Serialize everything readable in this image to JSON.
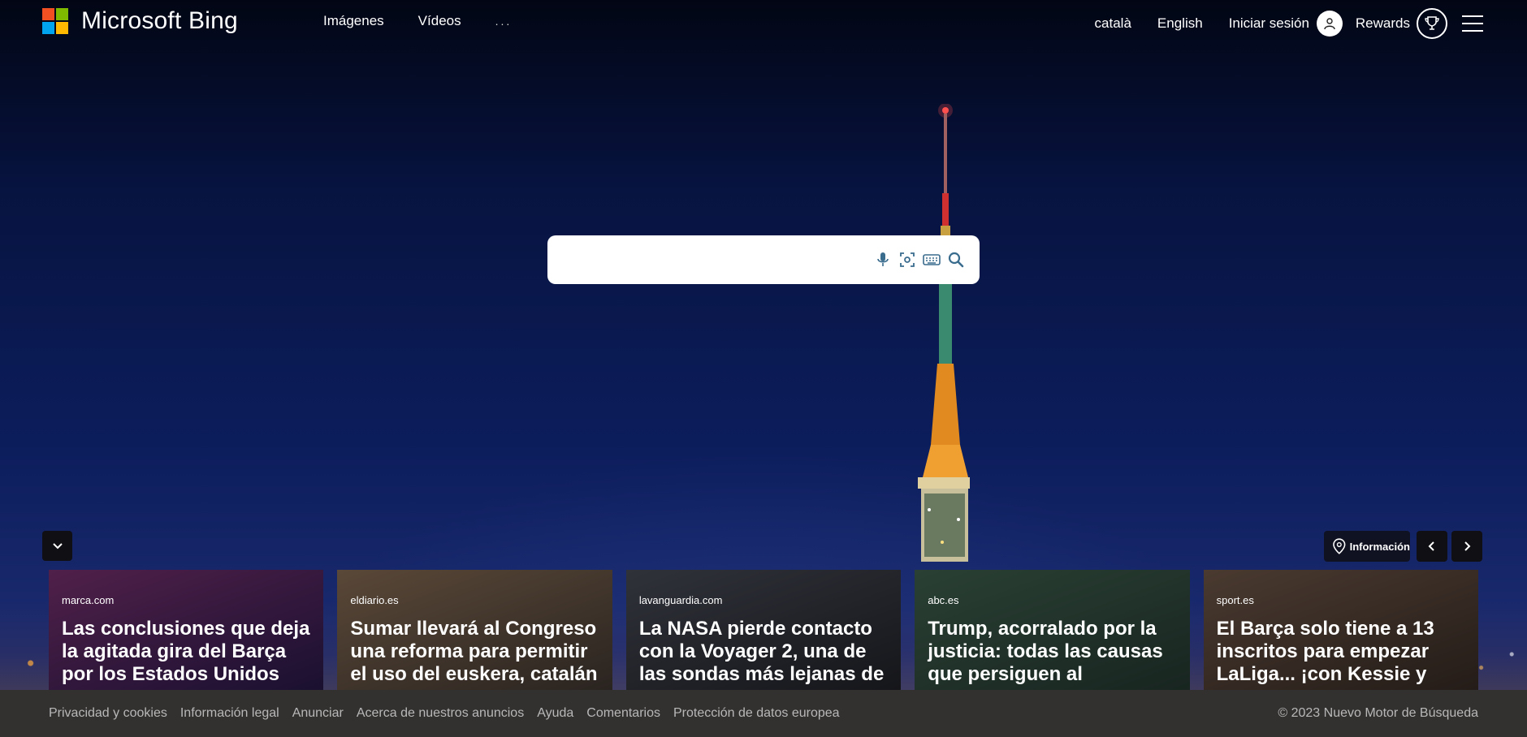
{
  "header": {
    "brand": "Microsoft Bing",
    "nav": [
      "Imágenes",
      "Vídeos",
      "..."
    ],
    "languages": [
      "català",
      "English"
    ],
    "signin_label": "Iniciar sesión",
    "rewards_label": "Rewards"
  },
  "logo_colors": [
    "#f25022",
    "#7fba00",
    "#00a4ef",
    "#ffb900"
  ],
  "search": {
    "placeholder": "",
    "icons": [
      "microphone-icon",
      "visual-search-icon",
      "keyboard-icon",
      "search-icon"
    ]
  },
  "controls": {
    "info_label": "Información"
  },
  "cards": [
    {
      "source": "marca.com",
      "title": "Las conclusiones que deja la agitada gira del Barça por los Estados Unidos",
      "bg": "#3a1c3a"
    },
    {
      "source": "eldiario.es",
      "title": "Sumar llevará al Congreso una reforma para permitir el uso del euskera, catalán",
      "bg": "#4a3a30"
    },
    {
      "source": "lavanguardia.com",
      "title": "La NASA pierde contacto con la Voyager 2, una de las sondas más lejanas de",
      "bg": "#24252a"
    },
    {
      "source": "abc.es",
      "title": "Trump, acorralado por la justicia: todas las causas que persiguen al",
      "bg": "#2a3a30"
    },
    {
      "source": "sport.es",
      "title": "El Barça solo tiene a 13 inscritos para empezar LaLiga... ¡con Kessie y",
      "bg": "#3a2e28"
    }
  ],
  "footer": {
    "links": [
      "Privacidad y cookies",
      "Información legal",
      "Anunciar",
      "Acerca de nuestros anuncios",
      "Ayuda",
      "Comentarios",
      "Protección de datos europea"
    ],
    "copyright": "© 2023 Nuevo Motor de Búsqueda"
  }
}
